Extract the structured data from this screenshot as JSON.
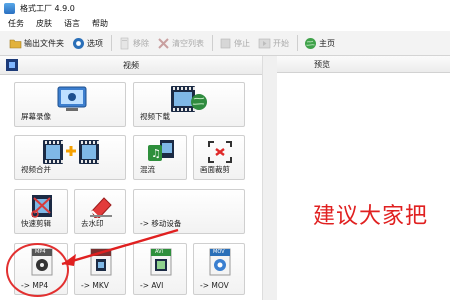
{
  "window": {
    "title": "格式工厂 4.9.0"
  },
  "menu": [
    "任务",
    "皮肤",
    "语言",
    "帮助"
  ],
  "toolbar": {
    "output_folder": "输出文件夹",
    "options": "选项",
    "remove": "移除",
    "clear_list": "清空列表",
    "stop": "停止",
    "start": "开始",
    "home": "主页"
  },
  "category": {
    "title": "视频"
  },
  "preview": {
    "title": "预览"
  },
  "tiles": {
    "screen_record": "屏幕录像",
    "video_download": "视频下载",
    "video_merge": "视频合并",
    "mix": "混流",
    "crop": "画面裁剪",
    "quick_cut": "快速剪辑",
    "remove_watermark": "去水印",
    "mobile": "-> 移动设备",
    "mp4": "-> MP4",
    "mkv": "-> MKV",
    "avi": "-> AVI",
    "mov": "-> MOV",
    "mp4_badge": "MP4",
    "avi_badge": "AVI",
    "mov_badge": "MOV"
  },
  "annotation": {
    "text": "建议大家把"
  },
  "colors": {
    "annotation_red": "#e02020",
    "toolbar_bg": "#f3f3f3"
  }
}
